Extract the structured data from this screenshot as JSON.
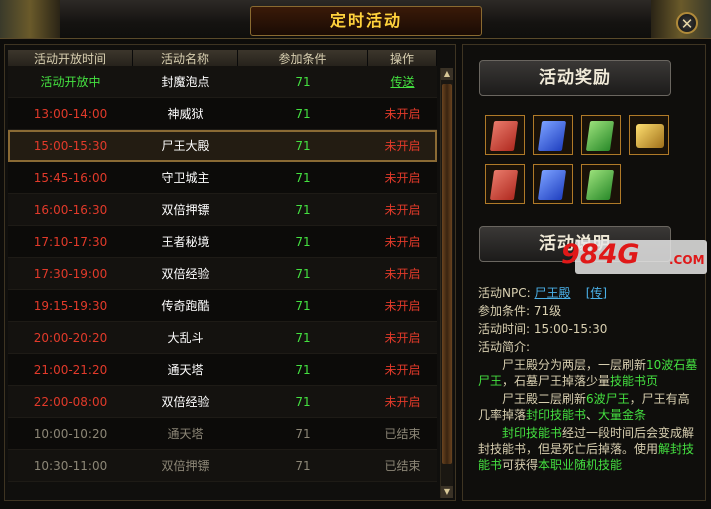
{
  "window": {
    "title": "定时活动",
    "close_label": "✕"
  },
  "table": {
    "headers": [
      "活动开放时间",
      "活动名称",
      "参加条件",
      "操作"
    ],
    "rows": [
      {
        "time": "活动开放中",
        "name": "封魔泡点",
        "cond": "71",
        "op": "传送",
        "state": "open"
      },
      {
        "time": "13:00-14:00",
        "name": "神威狱",
        "cond": "71",
        "op": "未开启",
        "state": "pending"
      },
      {
        "time": "15:00-15:30",
        "name": "尸王大殿",
        "cond": "71",
        "op": "未开启",
        "state": "pending",
        "selected": true
      },
      {
        "time": "15:45-16:00",
        "name": "守卫城主",
        "cond": "71",
        "op": "未开启",
        "state": "pending"
      },
      {
        "time": "16:00-16:30",
        "name": "双倍押镖",
        "cond": "71",
        "op": "未开启",
        "state": "pending"
      },
      {
        "time": "17:10-17:30",
        "name": "王者秘境",
        "cond": "71",
        "op": "未开启",
        "state": "pending"
      },
      {
        "time": "17:30-19:00",
        "name": "双倍经验",
        "cond": "71",
        "op": "未开启",
        "state": "pending"
      },
      {
        "time": "19:15-19:30",
        "name": "传奇跑酷",
        "cond": "71",
        "op": "未开启",
        "state": "pending"
      },
      {
        "time": "20:00-20:20",
        "name": "大乱斗",
        "cond": "71",
        "op": "未开启",
        "state": "pending"
      },
      {
        "time": "21:00-21:20",
        "name": "通天塔",
        "cond": "71",
        "op": "未开启",
        "state": "pending"
      },
      {
        "time": "22:00-08:00",
        "name": "双倍经验",
        "cond": "71",
        "op": "未开启",
        "state": "pending"
      },
      {
        "time": "10:00-10:20",
        "name": "通天塔",
        "cond": "71",
        "op": "已结束",
        "state": "ended"
      },
      {
        "time": "10:30-11:00",
        "name": "双倍押镖",
        "cond": "71",
        "op": "已结束",
        "state": "ended"
      }
    ]
  },
  "reward": {
    "title": "活动奖励",
    "items": [
      "red-book",
      "blue-book",
      "green-book",
      "gold-ingot",
      "red-book",
      "blue-book",
      "green-book"
    ]
  },
  "info": {
    "title": "活动说明",
    "npc_label": "活动NPC:",
    "npc_name": "尸王殿",
    "npc_link": "[传]",
    "cond": "参加条件: 71级",
    "time": "活动时间: 15:00-15:30",
    "intro_label": "活动简介:",
    "p1a": "尸王殿分为两层，一层刷新",
    "p1b": "10波石墓尸王",
    "p1c": "，石墓尸王掉落少量",
    "p1d": "技能书页",
    "p2a": "尸王殿二层刷新",
    "p2b": "6波尸王",
    "p2c": "，尸王有高几率掉落",
    "p2d": "封印技能书",
    "p2e": "、",
    "p2f": "大量金条",
    "p3a": "封印技能书",
    "p3b": "经过一段时间后会变成解封技能书，但是死亡后掉落。使用",
    "p3c": "解封技能书",
    "p3d": "可获得",
    "p3e": "本职业随机技能"
  },
  "watermark": {
    "text": "984G",
    "domain": ".COM"
  }
}
